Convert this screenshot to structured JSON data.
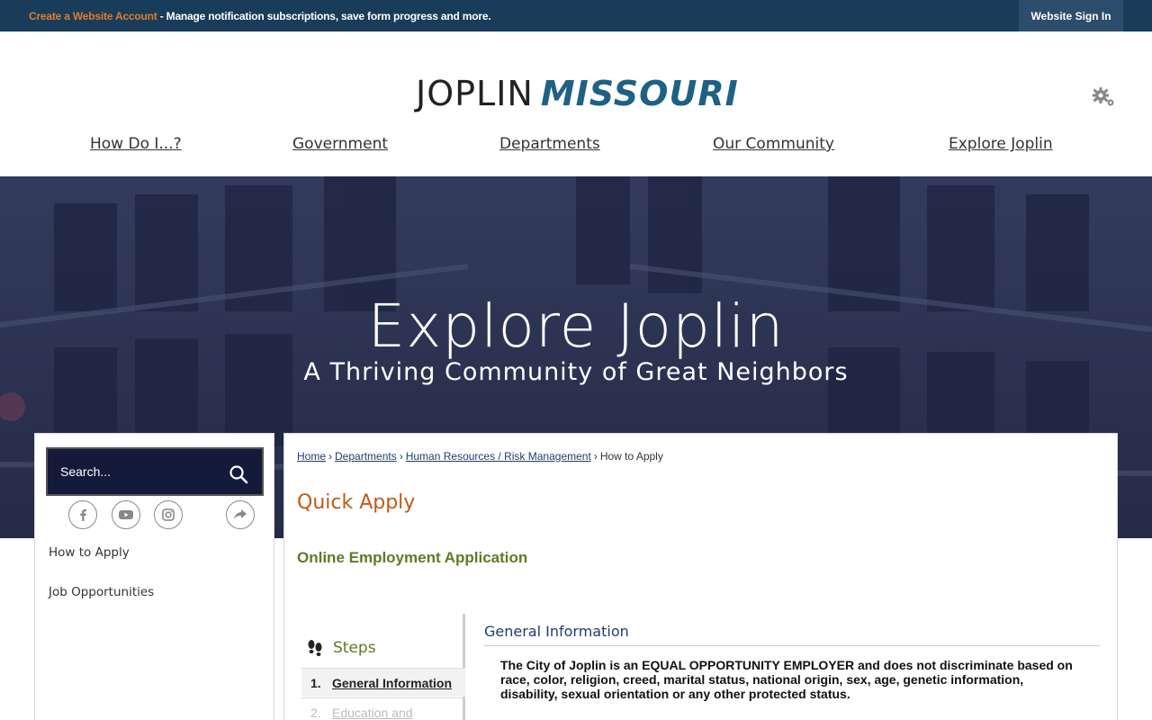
{
  "topbar": {
    "create_link": "Create a Website Account",
    "message": " - Manage notification subscriptions, save form progress and more.",
    "signin": "Website Sign In"
  },
  "header": {
    "logo_part1": "JOPLIN",
    "logo_part2": "MISSOURI",
    "nav": [
      "How Do I...?",
      "Government",
      "Departments",
      "Our Community",
      "Explore Joplin"
    ]
  },
  "hero": {
    "title": "Explore Joplin",
    "subtitle": "A Thriving Community of Great Neighbors"
  },
  "sidebar": {
    "search_placeholder": "Search...",
    "social": [
      "facebook-icon",
      "youtube-icon",
      "instagram-icon",
      "share-icon"
    ],
    "links": [
      "How to Apply",
      "Job Opportunities"
    ]
  },
  "main": {
    "breadcrumb": [
      "Home",
      "Departments",
      "Human Resources / Risk Management",
      "How to Apply"
    ],
    "title": "Quick Apply",
    "subtitle": "Online Employment Application",
    "steps_heading": "Steps",
    "steps": [
      {
        "number": "1.",
        "label": "General Information"
      },
      {
        "number": "2.",
        "label": "Education and"
      }
    ],
    "section_heading": "General Information",
    "section_text": "The City of Joplin is an EQUAL OPPORTUNITY EMPLOYER and does not discriminate based on race, color, religion, creed, marital status, national origin, sex, age, genetic information, disability, sexual orientation or any other protected status."
  },
  "colors": {
    "topbar": "#183c5a",
    "accent_orange": "#c05a18",
    "accent_green": "#5e7a27",
    "brand_blue": "#1f6185"
  }
}
